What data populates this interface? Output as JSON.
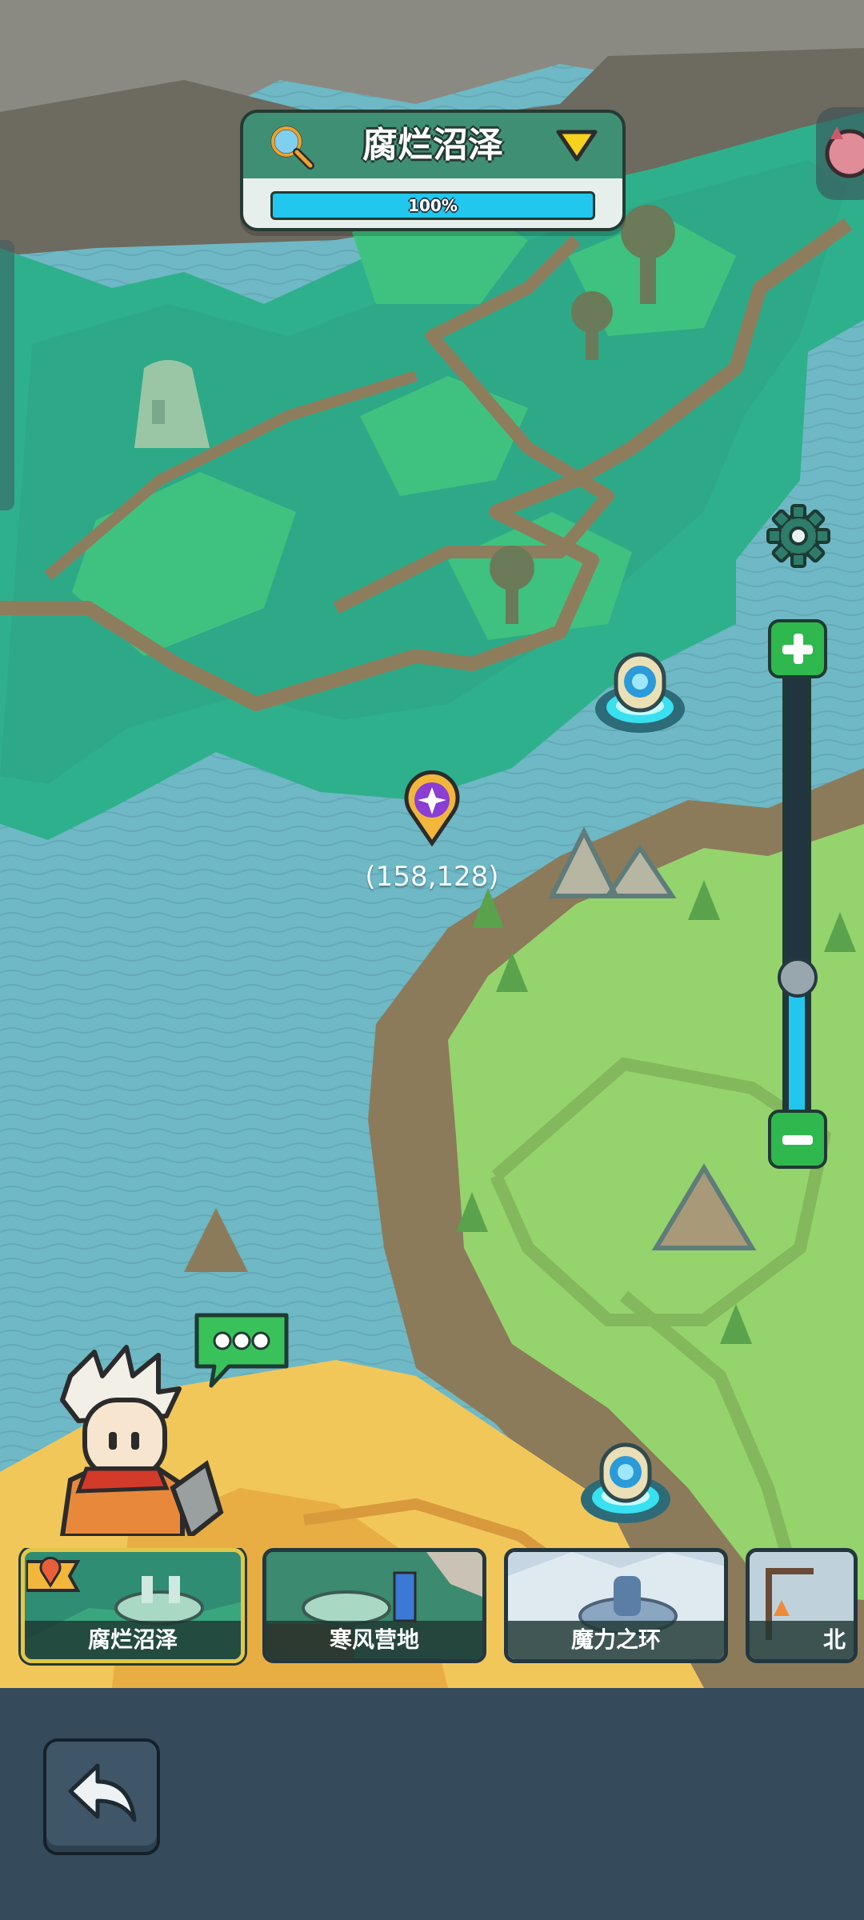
{
  "region": {
    "name": "腐烂沼泽",
    "progress_text": "100%",
    "progress": 1.0
  },
  "map": {
    "coordinates": "(158,128)",
    "zoom_level": 0.31
  },
  "regions_list": [
    {
      "name": "腐烂沼泽",
      "selected": true
    },
    {
      "name": "寒风营地",
      "selected": false
    },
    {
      "name": "魔力之环",
      "selected": false
    },
    {
      "name": "北",
      "selected": false
    }
  ],
  "icons": {
    "search": "search-icon",
    "dropdown": "chevron-down-icon",
    "settings": "gear-icon",
    "zoom_in": "plus-icon",
    "zoom_out": "minus-icon",
    "marker": "location-marker-icon",
    "chat": "speech-bubble-icon",
    "back": "back-arrow-icon",
    "current_location": "location-flag-icon"
  },
  "colors": {
    "accent": "#22c7ee",
    "panel": "#3f8f75",
    "button_green": "#2fb84e",
    "bottom_bar": "#354a5b",
    "selected_border": "#e3c74a"
  }
}
